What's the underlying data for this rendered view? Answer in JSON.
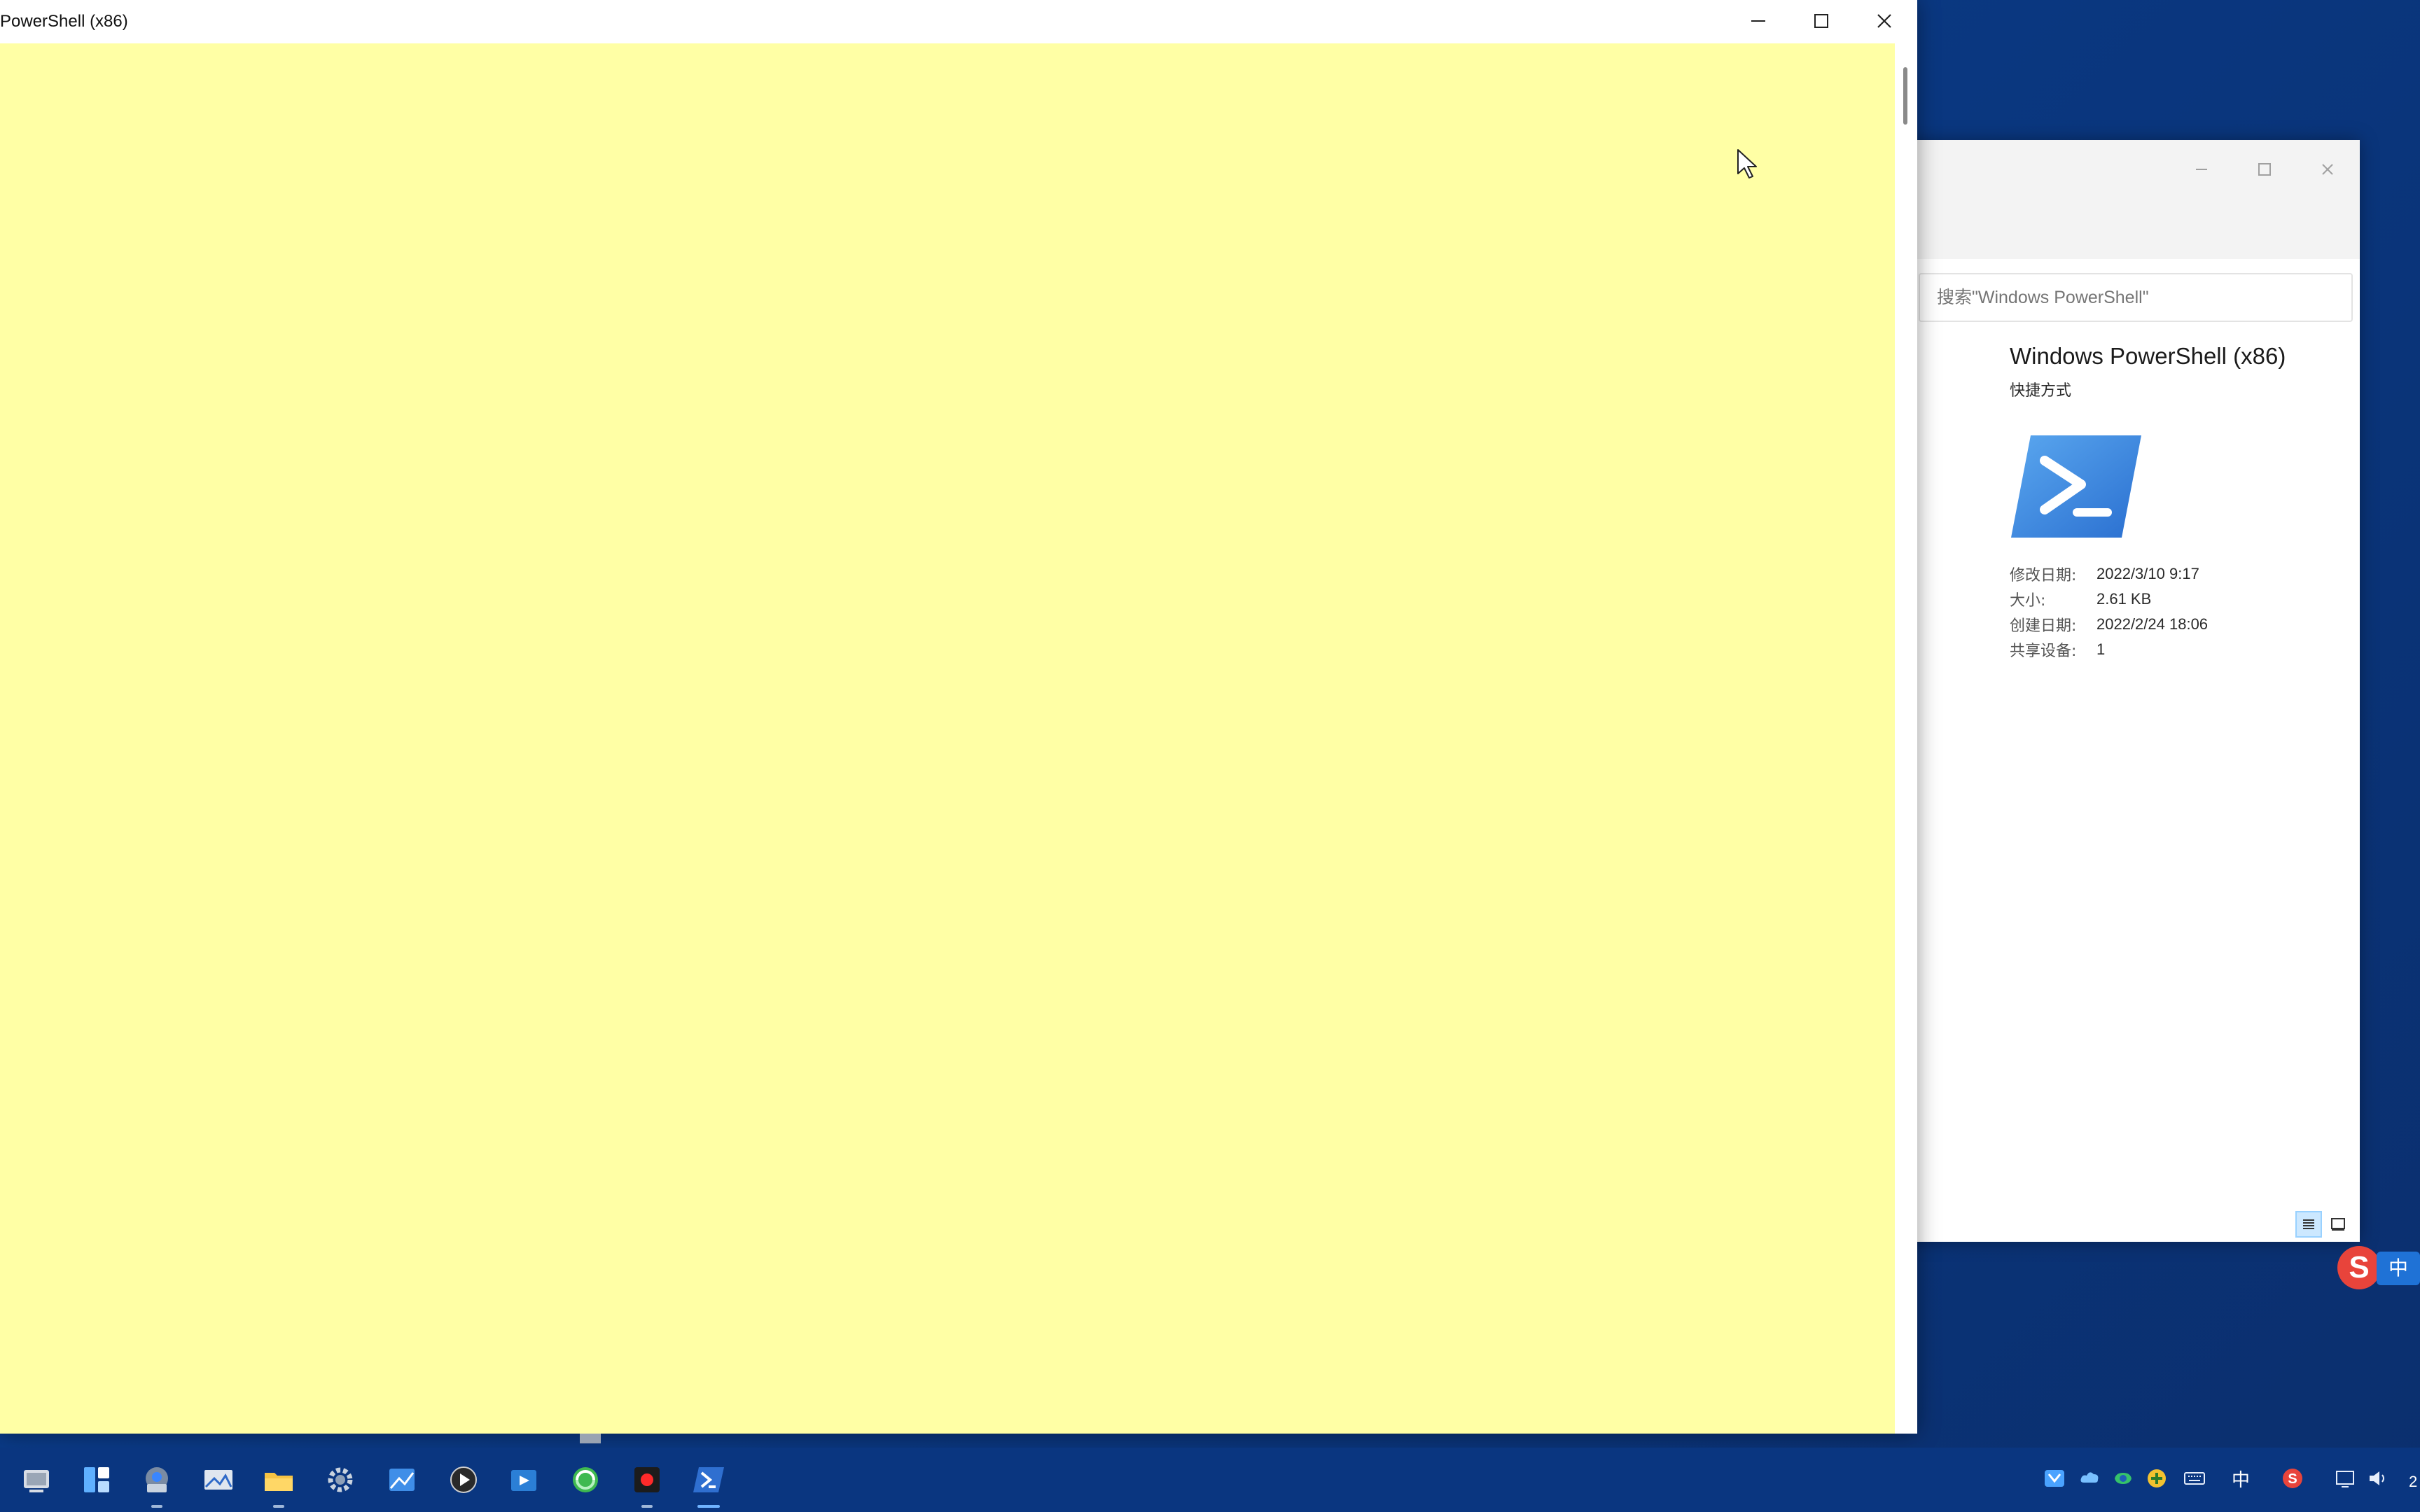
{
  "powershell_window": {
    "title": "PowerShell (x86)",
    "console_color": "#ffffa5"
  },
  "explorer": {
    "search_placeholder": "搜索\"Windows PowerShell\"",
    "selected_item": {
      "name": "Windows PowerShell (x86)",
      "type": "快捷方式"
    },
    "properties": [
      {
        "label": "修改日期:",
        "value": "2022/3/10 9:17"
      },
      {
        "label": "大小:",
        "value": "2.61 KB"
      },
      {
        "label": "创建日期:",
        "value": "2022/2/24 18:06"
      },
      {
        "label": "共享设备:",
        "value": "1"
      }
    ]
  },
  "ime": {
    "logo": "S",
    "language": "中"
  },
  "taskbar": {
    "pinned": [
      "task-view-icon",
      "widgets-icon",
      "network-monitor-icon",
      "image-viewer-icon",
      "file-explorer-icon",
      "settings-icon",
      "photos-icon",
      "media-player-icon",
      "video-editor-icon",
      "browser-icon",
      "screen-recorder-icon",
      "powershell-icon"
    ],
    "tray": {
      "ime_mode": "中",
      "clock_fragment": "2"
    }
  }
}
